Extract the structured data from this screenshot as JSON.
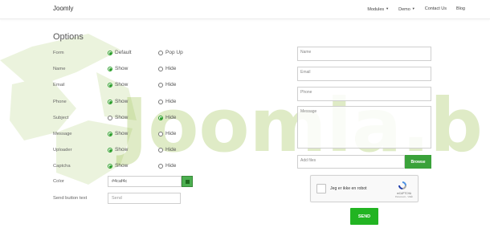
{
  "nav": {
    "brand": "Joomly",
    "items": [
      {
        "label": "Modules",
        "dropdown": true
      },
      {
        "label": "Demo",
        "dropdown": true
      },
      {
        "label": "Contact Us",
        "dropdown": false
      },
      {
        "label": "Blog",
        "dropdown": false
      }
    ]
  },
  "watermark": "Joomla.b",
  "options": {
    "heading": "Options",
    "rows": [
      {
        "label": "Form",
        "opt1": "Default",
        "opt2": "Pop Up",
        "selected": 1
      },
      {
        "label": "Name",
        "opt1": "Show",
        "opt2": "Hide",
        "selected": 1
      },
      {
        "label": "Email",
        "opt1": "Show",
        "opt2": "Hide",
        "selected": 1
      },
      {
        "label": "Phone",
        "opt1": "Show",
        "opt2": "Hide",
        "selected": 1
      },
      {
        "label": "Subject",
        "opt1": "Show",
        "opt2": "Hide",
        "selected": 2
      },
      {
        "label": "Message",
        "opt1": "Show",
        "opt2": "Hide",
        "selected": 1
      },
      {
        "label": "Uploader",
        "opt1": "Show",
        "opt2": "Hide",
        "selected": 1
      },
      {
        "label": "Captcha",
        "opt1": "Show",
        "opt2": "Hide",
        "selected": 1
      }
    ],
    "color": {
      "label": "Color",
      "value": "#4caf4c",
      "swatch": "#4caf50"
    },
    "send_text": {
      "label": "Send button text",
      "placeholder": "Send"
    }
  },
  "form": {
    "name_placeholder": "Name",
    "email_placeholder": "Email",
    "phone_placeholder": "Phone",
    "message_placeholder": "Message",
    "file_placeholder": "Add files",
    "browse_label": "Browse",
    "captcha_label": "Jeg er ikke en robot",
    "captcha_brand": "reCAPTCHA",
    "captcha_terms": "Personvern - Vilkår",
    "send_label": "SEND"
  },
  "colors": {
    "accent": "#2a9d2a",
    "send_button": "#22b422",
    "watermark": "#8bb832"
  }
}
